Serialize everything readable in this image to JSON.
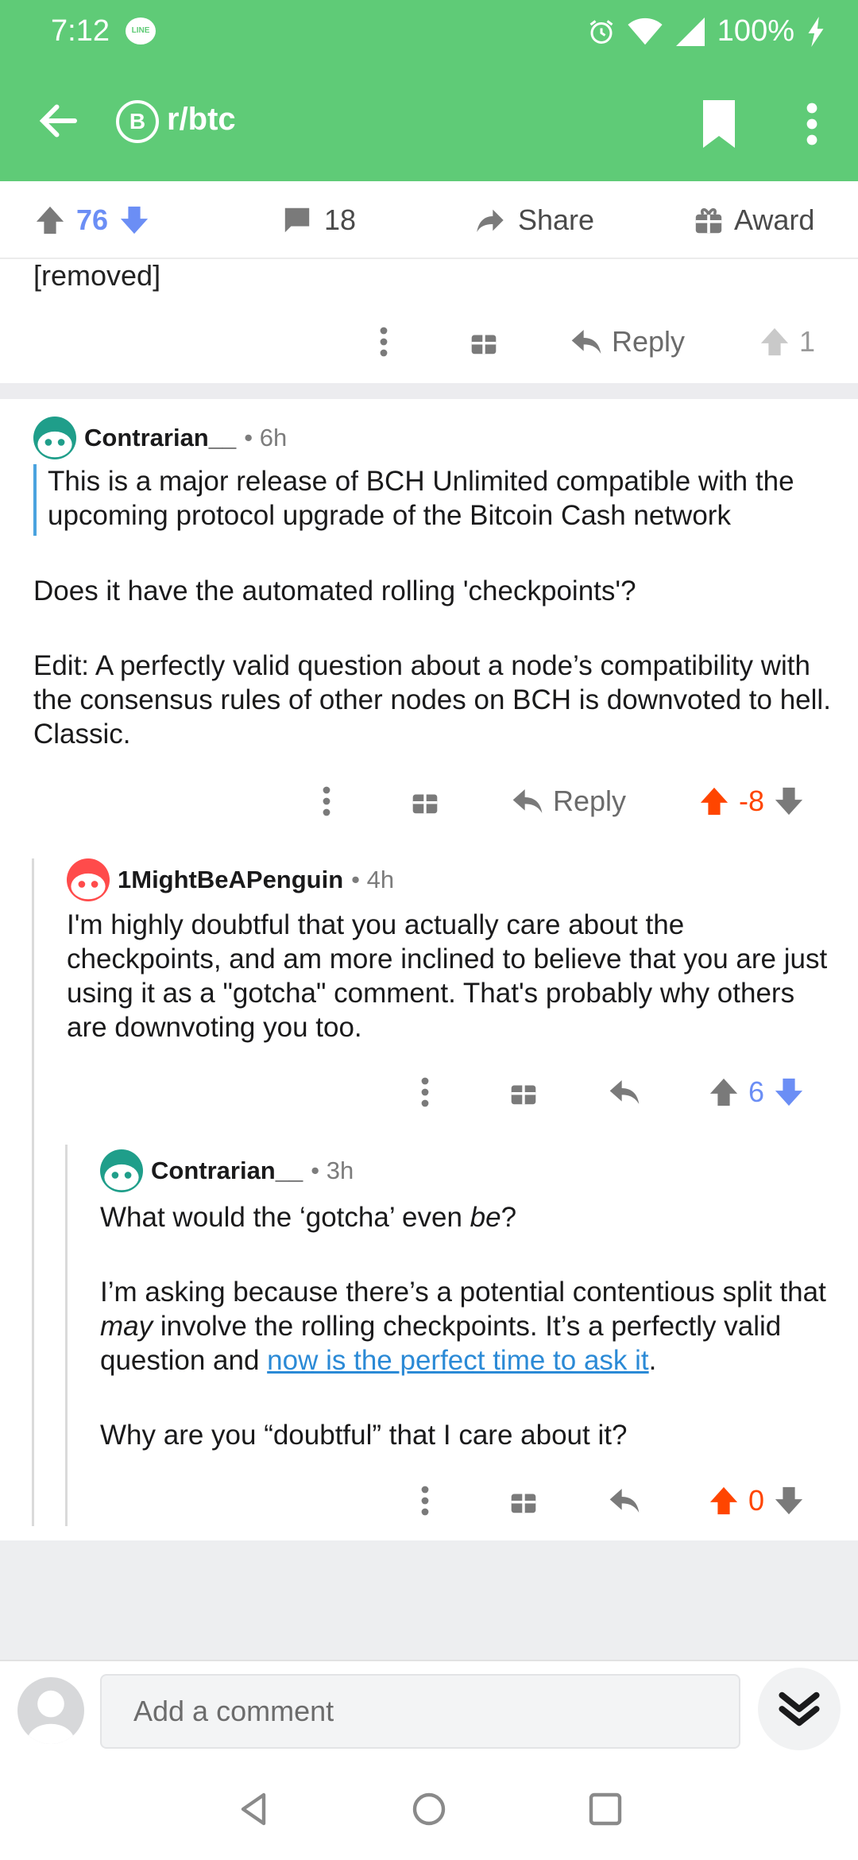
{
  "status_bar": {
    "time": "7:12",
    "line_badge": "LINE",
    "battery": "100%"
  },
  "app_bar": {
    "subreddit": "r/btc",
    "subreddit_icon_glyph": "B"
  },
  "post_actions": {
    "score": "76",
    "comments": "18",
    "share": "Share",
    "award": "Award"
  },
  "removed_comment": {
    "text": "[removed]",
    "reply": "Reply",
    "score": "1"
  },
  "comments": [
    {
      "author": "Contrarian__",
      "age": "6h",
      "quote": "This is a major release of BCH Unlimited compatible with the upcoming protocol upgrade of the Bitcoin Cash network",
      "paragraph1": "Does it have the automated rolling 'checkpoints'?",
      "paragraph2": "Edit: A perfectly valid question about a node’s compatibility with the consensus rules of other nodes on BCH is downvoted to hell. Classic.",
      "reply": "Reply",
      "score": "-8"
    },
    {
      "author": "1MightBeAPenguin",
      "age": "4h",
      "text": "I'm highly doubtful that you actually care about the checkpoints, and am more inclined to believe that you are just using it as a \"gotcha\" comment. That's probably why others are downvoting you too.",
      "score": "6"
    },
    {
      "author": "Contrarian__",
      "age": "3h",
      "p1_before": "What would the ‘gotcha’ even ",
      "p1_em": "be",
      "p1_after": "?",
      "p2_before": "I’m asking because there’s a potential contentious split that ",
      "p2_em": "may",
      "p2_mid": " involve the rolling checkpoints. It’s a perfectly valid question and ",
      "p2_link": "now is the perfect time to ask it",
      "p2_after": ".",
      "p3": "Why are you “doubtful” that I care about it?",
      "score": "0"
    }
  ],
  "composer": {
    "placeholder": "Add a comment"
  },
  "colors": {
    "app_green": "#5fcb77",
    "upvote_orange": "#ff4500",
    "downvote_blue": "#6b8ef5",
    "link_blue": "#2b8ad6"
  }
}
